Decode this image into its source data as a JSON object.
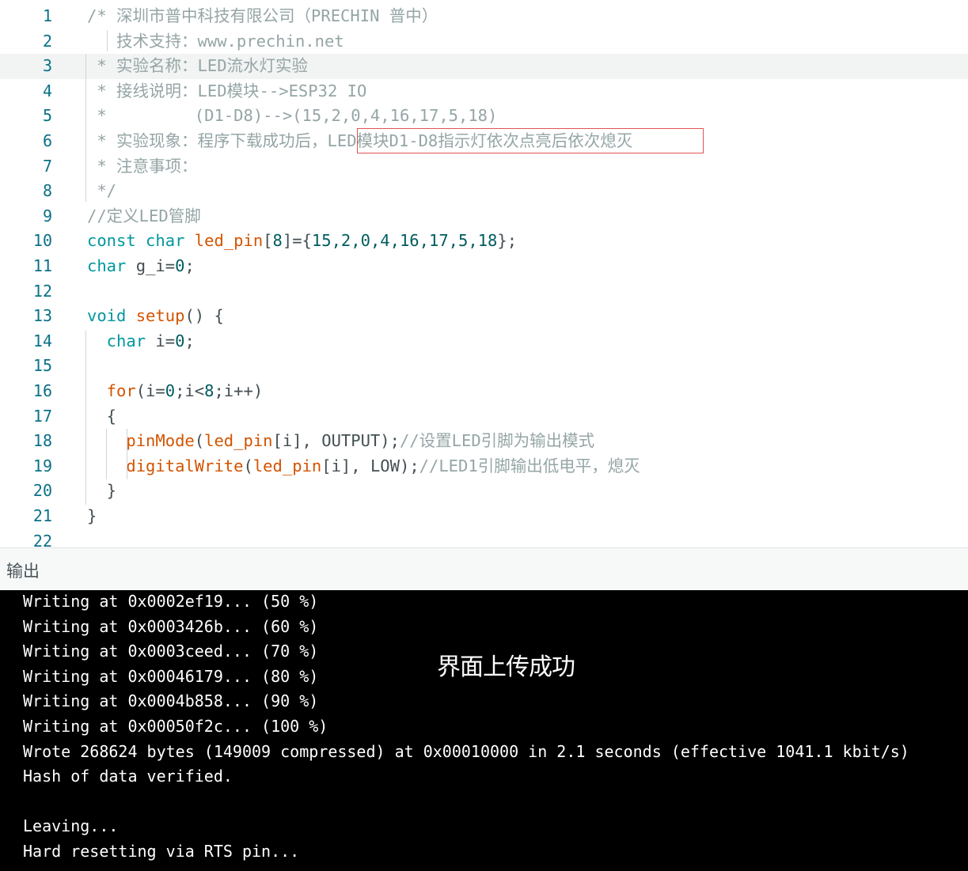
{
  "editor": {
    "lines": [
      {
        "n": "1",
        "t": [
          [
            "cm",
            "/* 深圳市普中科技有限公司（PRECHIN 普中）"
          ]
        ]
      },
      {
        "n": "2",
        "t": [
          [
            "cm",
            "   技术支持：www.prechin.net"
          ]
        ]
      },
      {
        "n": "3",
        "t": [
          [
            "cm",
            " * 实验名称：LED流水灯实验"
          ]
        ]
      },
      {
        "n": "4",
        "t": [
          [
            "cm",
            " * 接线说明：LED模块-->ESP32 IO"
          ]
        ]
      },
      {
        "n": "5",
        "t": [
          [
            "cm",
            " *         (D1-D8)-->(15,2,0,4,16,17,5,18)"
          ]
        ]
      },
      {
        "n": "6",
        "t": [
          [
            "cm",
            " * 实验现象：程序下载成功后，LED模块D1-D8指示灯依次点亮后依次熄灭"
          ]
        ]
      },
      {
        "n": "7",
        "t": [
          [
            "cm",
            " * 注意事项："
          ]
        ]
      },
      {
        "n": "8",
        "t": [
          [
            "cm",
            " */"
          ]
        ]
      },
      {
        "n": "9",
        "t": [
          [
            "cm",
            "//定义LED管脚"
          ]
        ]
      },
      {
        "n": "10",
        "t": [
          [
            "kw",
            "const char "
          ],
          [
            "fn",
            "led_pin"
          ],
          [
            "pl",
            "["
          ],
          [
            "nm",
            "8"
          ],
          [
            "pl",
            "]={"
          ],
          [
            "nm",
            "15,2,0,4,16,17,5,18"
          ],
          [
            "pl",
            "};"
          ]
        ]
      },
      {
        "n": "11",
        "t": [
          [
            "kw",
            "char "
          ],
          [
            "pl",
            "g_i="
          ],
          [
            "nm",
            "0"
          ],
          [
            "pl",
            ";"
          ]
        ]
      },
      {
        "n": "12",
        "t": [
          [
            "pl",
            ""
          ]
        ]
      },
      {
        "n": "13",
        "t": [
          [
            "kw",
            "void "
          ],
          [
            "fn",
            "setup"
          ],
          [
            "pl",
            "() {"
          ]
        ]
      },
      {
        "n": "14",
        "t": [
          [
            "kw",
            "  char "
          ],
          [
            "pl",
            "i="
          ],
          [
            "nm",
            "0"
          ],
          [
            "pl",
            ";"
          ]
        ]
      },
      {
        "n": "15",
        "t": [
          [
            "pl",
            ""
          ]
        ]
      },
      {
        "n": "16",
        "t": [
          [
            "fn",
            "  for"
          ],
          [
            "pl",
            "(i="
          ],
          [
            "nm",
            "0"
          ],
          [
            "pl",
            ";i<"
          ],
          [
            "nm",
            "8"
          ],
          [
            "pl",
            ";i++)"
          ]
        ]
      },
      {
        "n": "17",
        "t": [
          [
            "pl",
            "  {"
          ]
        ]
      },
      {
        "n": "18",
        "t": [
          [
            "fn",
            "    pinMode"
          ],
          [
            "pl",
            "("
          ],
          [
            "fn",
            "led_pin"
          ],
          [
            "pl",
            "[i], OUTPUT);"
          ],
          [
            "cm",
            "//设置LED引脚为输出模式"
          ]
        ]
      },
      {
        "n": "19",
        "t": [
          [
            "fn",
            "    digitalWrite"
          ],
          [
            "pl",
            "("
          ],
          [
            "fn",
            "led_pin"
          ],
          [
            "pl",
            "[i], LOW);"
          ],
          [
            "cm",
            "//LED1引脚输出低电平，熄灭"
          ]
        ]
      },
      {
        "n": "20",
        "t": [
          [
            "pl",
            "  }"
          ]
        ]
      },
      {
        "n": "21",
        "t": [
          [
            "pl",
            "}"
          ]
        ]
      },
      {
        "n": "22",
        "t": [
          [
            "pl",
            ""
          ]
        ]
      }
    ],
    "active_line": "3"
  },
  "output": {
    "title": "输出",
    "lines": [
      "Writing at 0x0002ef19... (50 %)",
      "Writing at 0x0003426b... (60 %)",
      "Writing at 0x0003ceed... (70 %)",
      "Writing at 0x00046179... (80 %)",
      "Writing at 0x0004b858... (90 %)",
      "Writing at 0x00050f2c... (100 %)",
      "Wrote 268624 bytes (149009 compressed) at 0x00010000 in 2.1 seconds (effective 1041.1 kbit/s)",
      "Hash of data verified.",
      "",
      "Leaving...",
      "Hard resetting via RTS pin..."
    ],
    "note": "界面上传成功"
  }
}
